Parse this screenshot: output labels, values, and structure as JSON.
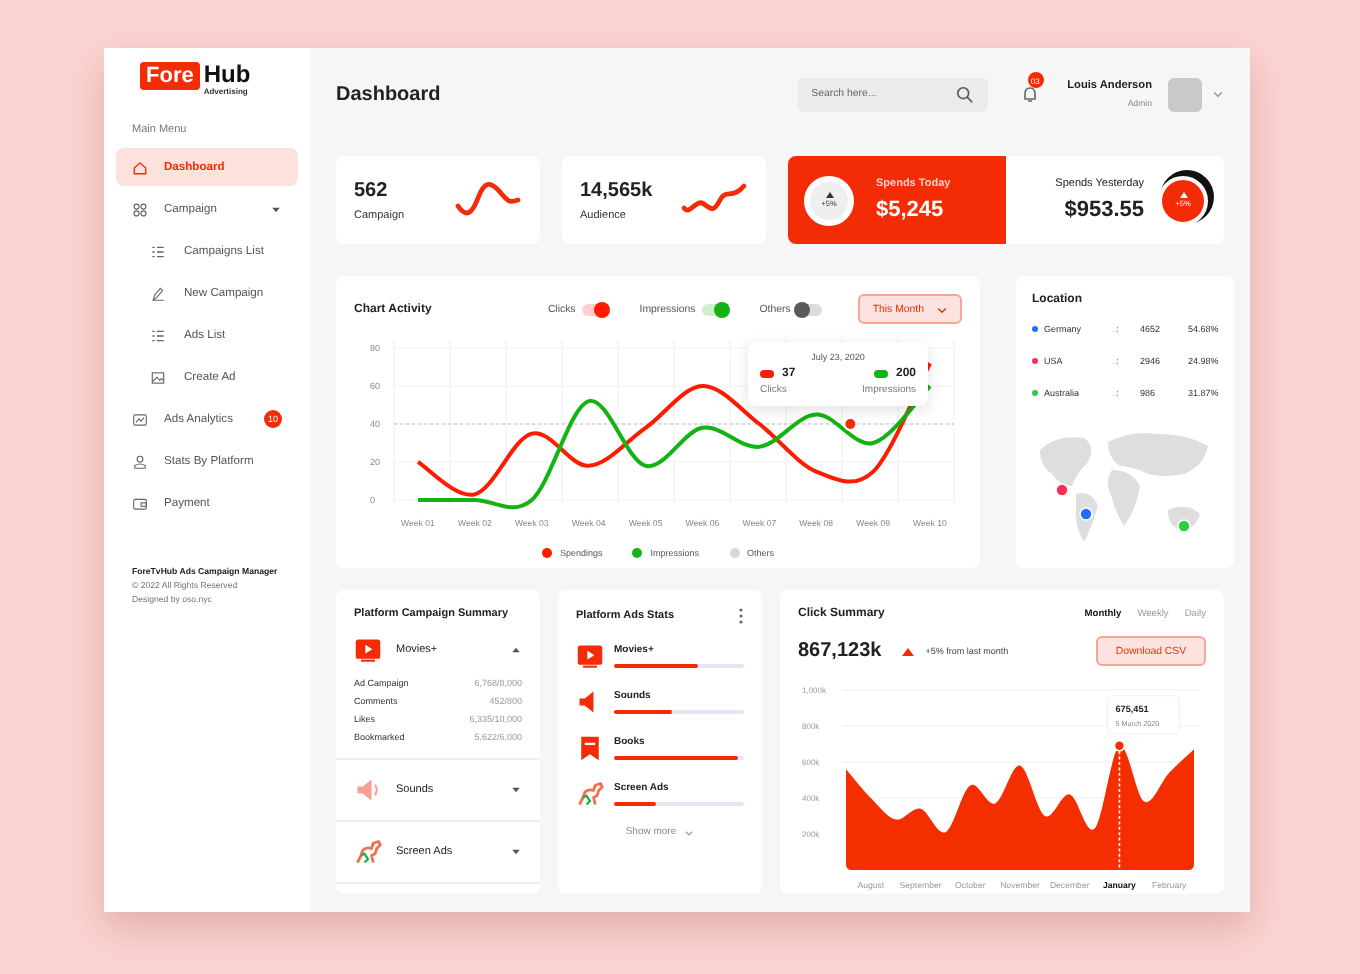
{
  "sidebar": {
    "logo": {
      "highlight": "Fore",
      "rest": "Hub",
      "tagline": "Advertising"
    },
    "menu_title": "Main Menu",
    "items": [
      {
        "label": "Dashboard",
        "kind": "link",
        "selected": true
      },
      {
        "label": "Campaign",
        "kind": "group",
        "selected": false,
        "expanded": true,
        "children": [
          {
            "label": "Campaigns List",
            "selected": false
          },
          {
            "label": "New Campaign",
            "selected": false
          },
          {
            "label": "Ads List",
            "selected": false
          },
          {
            "label": "Create Ad",
            "selected": false
          }
        ]
      },
      {
        "label": "Ads Analytics",
        "kind": "link",
        "selected": false,
        "badge": "10"
      },
      {
        "label": "Stats By Platform",
        "kind": "link",
        "selected": false
      },
      {
        "label": "Payment",
        "kind": "link",
        "selected": false
      }
    ],
    "footer": {
      "title": "ForeTvHub Ads Campaign Manager",
      "copyright": "© 2022 All Rights Reserved",
      "credit": "Designed by oso.nyc"
    }
  },
  "header": {
    "title": "Dashboard",
    "search": {
      "placeholder": "Search here..."
    },
    "notifications": {
      "badge": "03"
    },
    "user": {
      "name": "Louis Anderson",
      "role": "Admin"
    }
  },
  "stat_cards": [
    {
      "value": "562",
      "label": "Campaign"
    },
    {
      "value": "14,565k",
      "label": "Audience"
    }
  ],
  "spends": [
    {
      "kind": "accent",
      "label": "Spends Today",
      "value": "$5,245",
      "change": "+5%"
    },
    {
      "kind": "plain",
      "label": "Spends Yesterday",
      "value": "$953.55",
      "change": "+5%"
    }
  ],
  "chart_activity": {
    "title": "Chart Activity",
    "toggles": [
      {
        "label": "Clicks",
        "on": true,
        "color": "#ff1a00"
      },
      {
        "label": "Impressions",
        "on": true,
        "color": "#12b312"
      },
      {
        "label": "Others",
        "on": false,
        "color": "#5a5a5a"
      }
    ],
    "period": "This Month",
    "tooltip": {
      "date": "July 23, 2020",
      "items": [
        {
          "value": "37",
          "label": "Clicks",
          "color": "#ff1a00"
        },
        {
          "value": "200",
          "label": "Impressions",
          "color": "#12b312"
        }
      ]
    },
    "chart_data": {
      "type": "line",
      "categories": [
        "Week 01",
        "Week 02",
        "Week 03",
        "Week 04",
        "Week 05",
        "Week 06",
        "Week 07",
        "Week 08",
        "Week 09",
        "Week 10"
      ],
      "series": [
        {
          "name": "Spendings",
          "color": "#ff1a00",
          "values": [
            20,
            3,
            35,
            18,
            38,
            60,
            40,
            15,
            15,
            72
          ]
        },
        {
          "name": "Impressions",
          "color": "#12b312",
          "values": [
            0,
            0,
            0,
            52,
            18,
            38,
            28,
            45,
            30,
            60
          ]
        }
      ],
      "ylim": [
        0,
        80
      ],
      "yticks": [
        0,
        20,
        40,
        60,
        80
      ],
      "grid": true,
      "ref_lines": [
        {
          "axis": "y",
          "value": 40
        }
      ]
    },
    "extra_legend": [
      {
        "label": "Others",
        "color": "#d9d9d9"
      }
    ]
  },
  "location": {
    "title": "Location",
    "rows": [
      {
        "country": "Germany",
        "separator": ":",
        "count": "4652",
        "share": "54.68%",
        "color": "#1f6fff"
      },
      {
        "country": "USA",
        "separator": ":",
        "count": "2946",
        "share": "24.98%",
        "color": "#ff2d55"
      },
      {
        "country": "Australia",
        "separator": ":",
        "count": "986",
        "share": "31.87%",
        "color": "#2ecc40"
      }
    ]
  },
  "campaign_summary": {
    "title": "Platform Campaign Summary",
    "items": [
      {
        "label": "Movies+",
        "expanded": true,
        "stats": [
          {
            "label": "Ad Campaign",
            "value": "6,768/8,000"
          },
          {
            "label": "Comments",
            "value": "452/800"
          },
          {
            "label": "Likes",
            "value": "6,335/10,000"
          },
          {
            "label": "Bookmarked",
            "value": "5,622/6,000"
          }
        ]
      },
      {
        "label": "Sounds",
        "expanded": false
      },
      {
        "label": "Screen Ads",
        "expanded": false
      }
    ]
  },
  "ads_stats": {
    "title": "Platform Ads Stats",
    "items": [
      {
        "label": "Movies+",
        "level": 0.64
      },
      {
        "label": "Sounds",
        "level": 0.45
      },
      {
        "label": "Books",
        "level": 0.96
      },
      {
        "label": "Screen Ads",
        "level": 0.33
      }
    ],
    "show_more": "Show more"
  },
  "click_summary": {
    "title": "Click Summary",
    "tabs": [
      {
        "label": "Monthly",
        "selected": true
      },
      {
        "label": "Weekly",
        "selected": false
      },
      {
        "label": "Daily",
        "selected": false
      }
    ],
    "total": "867,123k",
    "change": "+5% from last month",
    "download": "Download CSV",
    "chart_data": {
      "type": "area",
      "categories": [
        null,
        "August",
        null,
        "September",
        null,
        "October",
        null,
        "November",
        null,
        "December",
        null,
        "January",
        null,
        "February",
        null
      ],
      "series": [
        {
          "color": "#f52e00",
          "values": [
            560,
            400,
            280,
            340,
            210,
            470,
            370,
            580,
            300,
            420,
            230,
            690,
            380,
            540,
            670
          ]
        }
      ],
      "ylim": [
        0,
        1000
      ],
      "grid": true,
      "yticks": [
        {
          "value": 200,
          "label": "200k"
        },
        {
          "value": 400,
          "label": "400k"
        },
        {
          "value": 600,
          "label": "600k"
        },
        {
          "value": 800,
          "label": "800k"
        },
        {
          "value": 1000,
          "label": "1,000k"
        }
      ],
      "annotations": [
        "675,451"
      ]
    },
    "tooltip_date": "5 March 2020"
  }
}
